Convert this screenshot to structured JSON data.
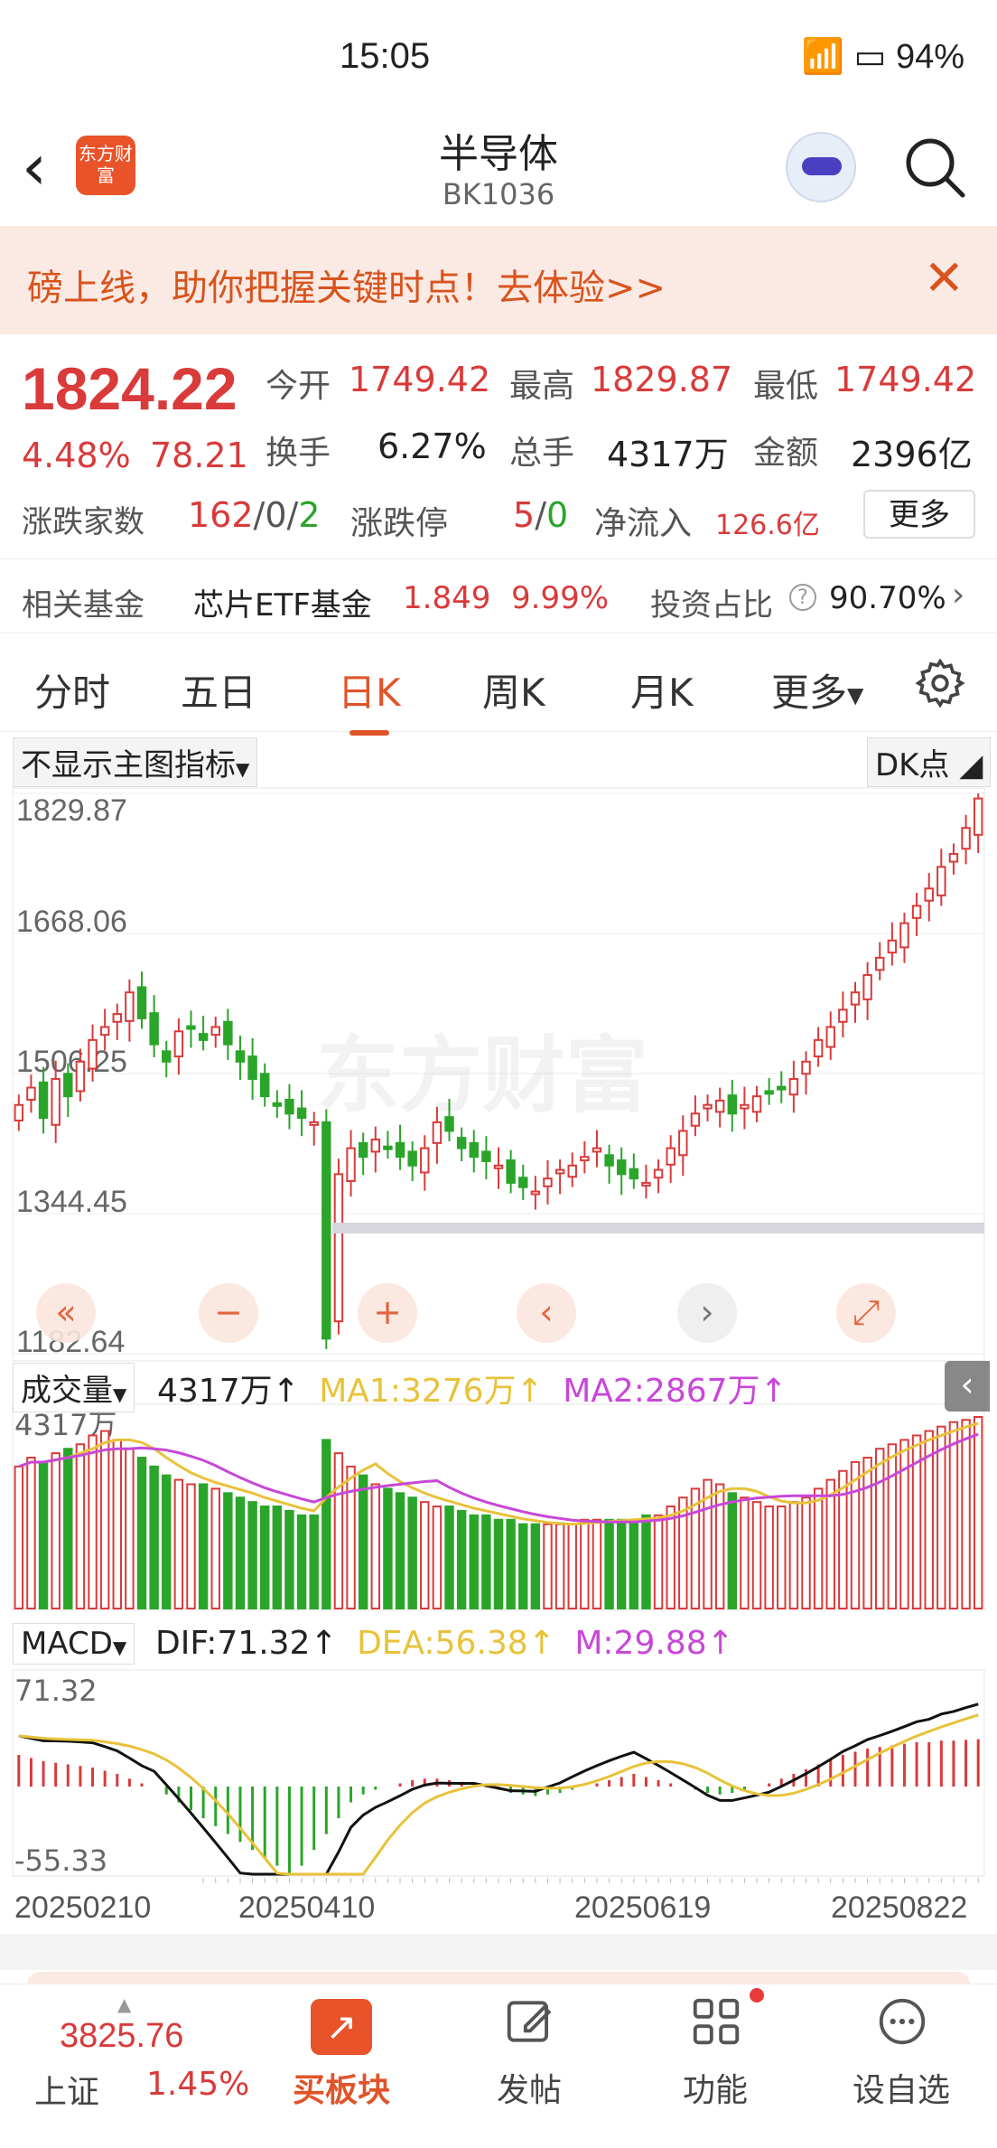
{
  "status_bar": {
    "time": "15:05",
    "battery": "94%"
  },
  "header": {
    "title": "半导体",
    "code": "BK1036",
    "logo_text": "东方财富"
  },
  "banner": {
    "text": "磅上线，助你把握关键时点！去体验>>"
  },
  "quote": {
    "price": "1824.22",
    "change_pct": "4.48%",
    "change": "78.21",
    "open_label": "今开",
    "open": "1749.42",
    "high_label": "最高",
    "high": "1829.87",
    "low_label": "最低",
    "low": "1749.42",
    "turnover_label": "换手",
    "turnover": "6.27%",
    "volume_label": "总手",
    "volume": "4317万",
    "amount_label": "金额",
    "amount": "2396亿",
    "breadth_label": "涨跌家数",
    "breadth_up": "162",
    "breadth_flat": "0",
    "breadth_down": "2",
    "limit_label": "涨跌停",
    "limit_up": "5",
    "limit_down": "0",
    "inflow_label": "净流入",
    "inflow": "126.6亿",
    "more_button": "更多"
  },
  "fund": {
    "label": "相关基金",
    "name": "芯片ETF基金",
    "price": "1.849",
    "pct": "9.99%",
    "ratio_label": "投资占比",
    "ratio": "90.70%"
  },
  "tabs": [
    "分时",
    "五日",
    "日K",
    "周K",
    "月K",
    "更多"
  ],
  "active_tab": "日K",
  "chart_controls": {
    "indicator_select": "不显示主图指标",
    "dk_button": "DK点"
  },
  "volume_panel": {
    "select": "成交量",
    "value": "4317万",
    "ma1": "MA1:3276万",
    "ma2": "MA2:2867万",
    "axis_max": "4317万"
  },
  "macd_panel": {
    "select": "MACD",
    "dif": "DIF:71.32",
    "dea": "DEA:56.38",
    "m": "M:29.88",
    "axis_max": "71.32",
    "axis_min": "-55.33"
  },
  "watermark": "东方财富",
  "colors": {
    "up": "#d93a3a",
    "down": "#2aa52a",
    "accent": "#e0542a",
    "ma1": "#e8c23a",
    "ma2": "#c847d8"
  },
  "chart_data": [
    {
      "type": "candlestick",
      "title": "",
      "y_ticks": [
        "1829.87",
        "1668.06",
        "1506.25",
        "1344.45",
        "1182.64"
      ],
      "ylim": [
        1182.64,
        1829.87
      ],
      "x_ticks": [
        "20250210",
        "20250410",
        "20250619",
        "20250822"
      ],
      "close": [
        1470,
        1490,
        1455,
        1500,
        1480,
        1520,
        1545,
        1560,
        1575,
        1600,
        1570,
        1540,
        1520,
        1555,
        1560,
        1545,
        1560,
        1540,
        1520,
        1500,
        1480,
        1470,
        1460,
        1455,
        1450,
        1200,
        1390,
        1420,
        1410,
        1430,
        1420,
        1410,
        1400,
        1420,
        1450,
        1440,
        1420,
        1410,
        1405,
        1400,
        1380,
        1375,
        1370,
        1385,
        1395,
        1400,
        1410,
        1420,
        1400,
        1390,
        1385,
        1380,
        1395,
        1420,
        1440,
        1460,
        1470,
        1475,
        1460,
        1470,
        1480,
        1485,
        1490,
        1500,
        1520,
        1545,
        1560,
        1580,
        1600,
        1620,
        1640,
        1660,
        1680,
        1700,
        1720,
        1745,
        1760,
        1790,
        1824
      ]
    },
    {
      "type": "bar",
      "title": "",
      "series": [
        {
          "name": "成交量",
          "values": [
            3200,
            3400,
            3300,
            3500,
            3600,
            3700,
            3900,
            4000,
            3800,
            3600,
            3400,
            3200,
            3000,
            2900,
            2800,
            2800,
            2700,
            2600,
            2500,
            2400,
            2300,
            2300,
            2200,
            2100,
            2100,
            3800,
            3500,
            3200,
            3000,
            2800,
            2700,
            2600,
            2500,
            2400,
            2300,
            2300,
            2200,
            2100,
            2100,
            2000,
            2000,
            1900,
            1900,
            1900,
            1900,
            1900,
            2000,
            2000,
            2000,
            2000,
            2000,
            2100,
            2100,
            2300,
            2500,
            2700,
            2900,
            2800,
            2600,
            2500,
            2400,
            2300,
            2300,
            2400,
            2500,
            2700,
            2900,
            3100,
            3300,
            3400,
            3600,
            3700,
            3800,
            3900,
            4000,
            4100,
            4200,
            4250,
            4317
          ]
        }
      ]
    },
    {
      "type": "bar",
      "title": "",
      "series": [
        {
          "name": "MACD",
          "values": [
            20,
            18,
            16,
            15,
            14,
            13,
            12,
            10,
            8,
            5,
            2,
            0,
            -5,
            -10,
            -15,
            -20,
            -25,
            -30,
            -35,
            -40,
            -45,
            -50,
            -55,
            -50,
            -40,
            -30,
            -20,
            -10,
            -5,
            -2,
            0,
            2,
            4,
            5,
            5,
            4,
            3,
            2,
            0,
            -2,
            -4,
            -5,
            -6,
            -5,
            -4,
            -2,
            0,
            2,
            4,
            6,
            8,
            6,
            4,
            2,
            0,
            -2,
            -4,
            -5,
            -4,
            -2,
            0,
            2,
            5,
            8,
            11,
            14,
            17,
            20,
            22,
            24,
            25,
            26,
            27,
            28,
            28,
            29,
            29,
            29.5,
            29.88
          ]
        }
      ]
    }
  ],
  "bottom_nav": {
    "index_value": "3825.76",
    "index_name": "上证",
    "index_pct": "1.45%",
    "items": [
      "买板块",
      "发帖",
      "功能",
      "设自选"
    ]
  }
}
